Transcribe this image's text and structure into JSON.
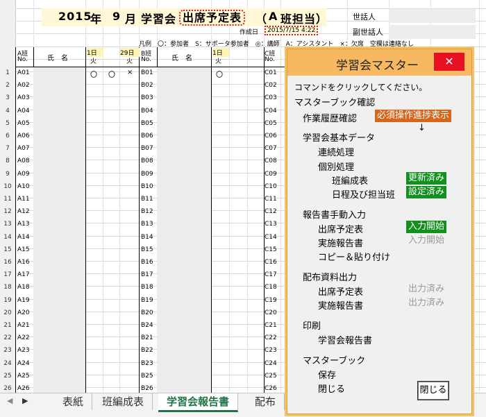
{
  "sheet": {
    "title": {
      "year": "2015",
      "year_unit": "年",
      "month": "9",
      "month_unit": "月",
      "name": "学習会",
      "doc": "出席予定表",
      "paren_open": "（",
      "group": "A",
      "group_label": "班担当）"
    },
    "seiwanin": "世話人",
    "fuku_seiwanin": "副世話人",
    "created_label": "作成日",
    "created_value": "2015/7/15 4:22",
    "legend": "凡例　〇：参加者　S：サポータ参加者　◎：講師　A：アシスタント　×：欠席　空欄は連絡なし",
    "col_a": {
      "label": "A班",
      "no": "No."
    },
    "col_b": {
      "label": "B班",
      "no": "No."
    },
    "col_c": {
      "label": "C班",
      "no": "No."
    },
    "name_header": "氏　名",
    "day1": "1日",
    "day29": "29日",
    "weekday": "火",
    "row1_marks": [
      "〇",
      "〇",
      "×"
    ],
    "row1_b_mark": "〇",
    "row_numbers": [
      "1",
      "2",
      "3",
      "4",
      "5",
      "6",
      "7",
      "8",
      "9",
      "10",
      "11",
      "12",
      "13",
      "14",
      "15",
      "16",
      "17",
      "18",
      "19",
      "20",
      "21",
      "22",
      "23",
      "24",
      "25",
      "26"
    ],
    "a_ids": [
      "A01",
      "A02",
      "A03",
      "A04",
      "A05",
      "A06",
      "A07",
      "A08",
      "A09",
      "A10",
      "A11",
      "A12",
      "A13",
      "A14",
      "A15",
      "A16",
      "A17",
      "A18",
      "A19",
      "A20",
      "A21",
      "A22",
      "A23",
      "A24",
      "A25",
      "A26"
    ],
    "b_ids": [
      "B01",
      "B02",
      "B03",
      "B04",
      "B05",
      "B06",
      "B07",
      "B08",
      "B09",
      "B10",
      "B11",
      "B12",
      "B13",
      "B14",
      "B15",
      "B16",
      "B17",
      "B18",
      "B19",
      "B20",
      "B24",
      "B21",
      "B22",
      "B23",
      "B25",
      "B26"
    ],
    "c_ids": [
      "C01",
      "C02",
      "C03",
      "C04",
      "C05",
      "C06",
      "C07",
      "C08",
      "C09",
      "C10",
      "C11",
      "C12",
      "C13",
      "C14",
      "C15",
      "C16",
      "C17",
      "C18",
      "C19",
      "C20",
      "C21",
      "C22",
      "C23",
      "C24",
      "C25",
      "C26"
    ]
  },
  "tabs": [
    "表紙",
    "班編成表",
    "学習会報告書",
    "配布"
  ],
  "active_tab_index": 2,
  "dialog": {
    "title": "学習会マスター",
    "close_glyph": "✕",
    "instruction": "コマンドをクリックしてください。",
    "master_check": "マスターブック確認",
    "history": "作業履歴確認",
    "history_badge": "必須操作進捗表示",
    "arrow": "↓",
    "basic_data": "学習会基本データ",
    "continuous": "連続処理",
    "individual": "個別処理",
    "group_table": "班編成表",
    "group_table_status": "更新済み",
    "schedule": "日程及び担当班",
    "schedule_status": "設定済み",
    "manual_input": "報告書手動入力",
    "attendance": "出席予定表",
    "attendance_status": "入力開始",
    "report": "実施報告書",
    "report_status": "入力開始",
    "copy_paste": "コピー＆貼り付け",
    "distribution": "配布資料出力",
    "dist_attendance": "出席予定表",
    "dist_attendance_status": "出力済み",
    "dist_report": "実施報告書",
    "dist_report_status": "出力済み",
    "print": "印刷",
    "print_report": "学習会報告書",
    "masterbook": "マスターブック",
    "save": "保存",
    "close_book": "閉じる",
    "close_button": "閉じる"
  },
  "colors": {
    "accent_green": "#12911e",
    "accent_orange": "#d5661c",
    "dialog_title": "#f7b862",
    "excel_green": "#217346"
  }
}
